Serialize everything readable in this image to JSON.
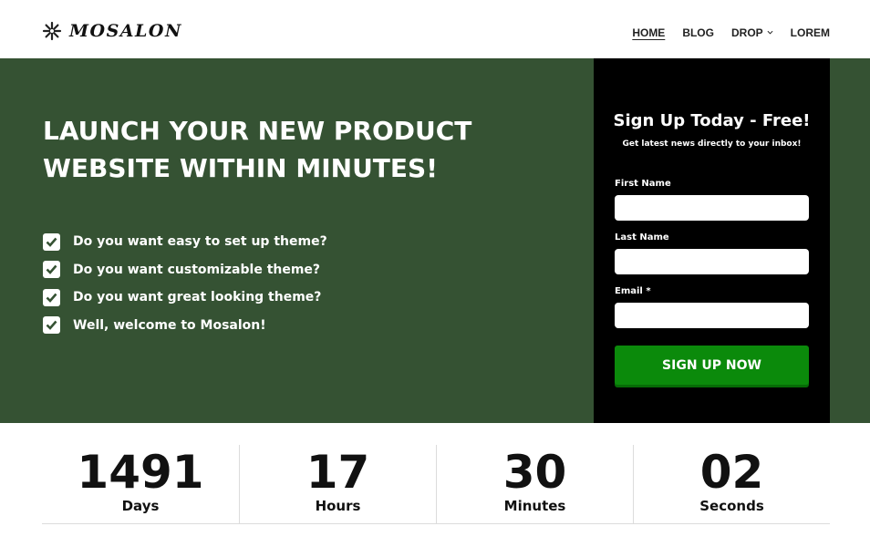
{
  "header": {
    "logo_text": "MOSALON",
    "logo_icon": "asterisk-flower-icon",
    "nav": [
      {
        "label": "HOME",
        "active": true
      },
      {
        "label": "BLOG",
        "active": false
      },
      {
        "label": "DROP",
        "active": false,
        "has_dropdown": true
      },
      {
        "label": "LOREM",
        "active": false
      }
    ]
  },
  "hero": {
    "title_line1": "LAUNCH YOUR NEW PRODUCT",
    "title_line2": "WEBSITE WITHIN MINUTES!",
    "background": "#355233",
    "checklist": [
      "Do you want easy to set up theme?",
      "Do you want customizable theme?",
      "Do you want great looking theme?",
      "Well, welcome to Mosalon!"
    ]
  },
  "signup": {
    "title": "Sign Up Today - Free!",
    "subtitle": "Get latest news directly to your inbox!",
    "first_name_label": "First Name",
    "first_name_value": "",
    "last_name_label": "Last Name",
    "last_name_value": "",
    "email_label": "Email *",
    "email_value": "",
    "button_label": "SIGN UP NOW",
    "button_color": "#0b8a0b"
  },
  "countdown": [
    {
      "value": "1491",
      "label": "Days"
    },
    {
      "value": "17",
      "label": "Hours"
    },
    {
      "value": "30",
      "label": "Minutes"
    },
    {
      "value": "02",
      "label": "Seconds"
    }
  ]
}
